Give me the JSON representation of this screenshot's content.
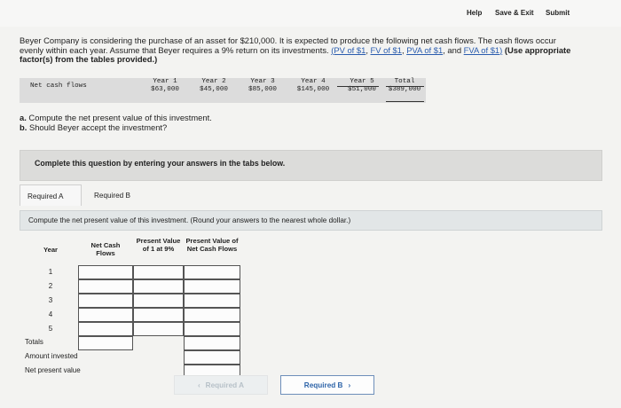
{
  "topbar": {
    "help": "Help",
    "save_exit": "Save & Exit",
    "submit": "Submit"
  },
  "problem": {
    "text1": "Beyer Company is considering the purchase of an asset for $210,000. It is expected to produce the following net cash flows. The cash flows occur evenly within each year. Assume that Beyer requires a 9% return on its investments. ",
    "link_pv1": "(PV of $1",
    "sep1": ", ",
    "link_fv1": "FV of $1",
    "sep2": ", ",
    "link_pva1": "PVA of $1",
    "sep3": ", and ",
    "link_fva1": "FVA of $1)",
    "bold": " (Use appropriate factor(s) from the tables provided.)"
  },
  "cash_flows": {
    "row_label": "Net cash flows",
    "columns": [
      {
        "year": "Year 1",
        "amount": "$63,000"
      },
      {
        "year": "Year 2",
        "amount": "$45,000"
      },
      {
        "year": "Year 3",
        "amount": "$85,000"
      },
      {
        "year": "Year 4",
        "amount": "$145,000"
      },
      {
        "year": "Year 5",
        "amount": "$51,000"
      },
      {
        "year": "Total",
        "amount": "$389,000"
      }
    ]
  },
  "questions": {
    "a_label": "a.",
    "a_text": " Compute the net present value of this investment.",
    "b_label": "b.",
    "b_text": " Should Beyer accept the investment?"
  },
  "banner": "Complete this question by entering your answers in the tabs below.",
  "tabs": [
    {
      "label": "Required A"
    },
    {
      "label": "Required B"
    }
  ],
  "instruction": "Compute the net present value of this investment. (Round your answers to the nearest whole dollar.)",
  "answer_table": {
    "headers": {
      "year": "Year",
      "net_cash_flows": "Net Cash Flows",
      "pv_factor": "Present Value of 1 at 9%",
      "pv_cash_flows": "Present Value of Net Cash Flows"
    },
    "years": [
      "1",
      "2",
      "3",
      "4",
      "5"
    ],
    "totals_label": "Totals",
    "amount_invested_label": "Amount invested",
    "npv_label": "Net present value"
  },
  "nav": {
    "prev": "Required A",
    "next": "Required B"
  },
  "colors": {
    "link": "#2a5cae",
    "next_button": "#2f65a9",
    "disabled": "#b7c1c8"
  }
}
